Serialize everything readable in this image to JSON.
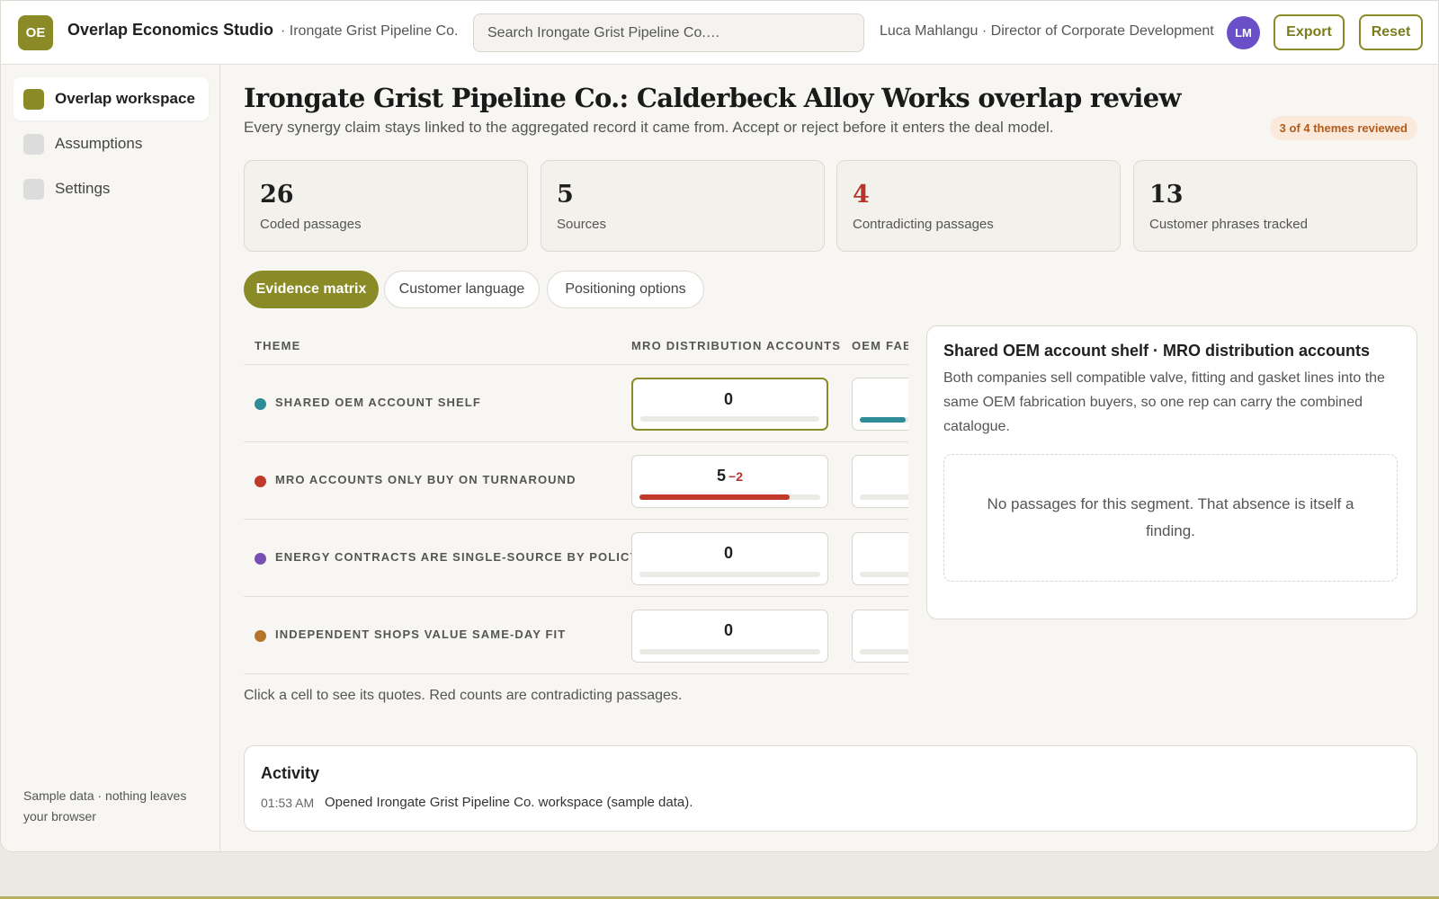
{
  "app": {
    "logo": "OE",
    "name": "Overlap Economics Studio",
    "company_crumb": "· Irongate Grist Pipeline Co.",
    "search_placeholder": "Search Irongate Grist Pipeline Co.…",
    "user": "Luca Mahlangu · Director of Corporate Development",
    "avatar": "LM",
    "export_label": "Export",
    "reset_label": "Reset"
  },
  "sidebar": {
    "items": [
      {
        "label": "Overlap workspace",
        "active": true
      },
      {
        "label": "Assumptions",
        "active": false
      },
      {
        "label": "Settings",
        "active": false
      }
    ],
    "footer": "Sample data · nothing leaves your browser"
  },
  "page": {
    "title": "Irongate Grist Pipeline Co.: Calderbeck Alloy Works overlap review",
    "subtitle": "Every synergy claim stays linked to the aggregated record it came from. Accept or reject before it enters the deal model.",
    "reviewed_badge": "3 of 4 themes reviewed"
  },
  "stats": [
    {
      "value": "26",
      "label": "Coded passages"
    },
    {
      "value": "5",
      "label": "Sources"
    },
    {
      "value": "4",
      "label": "Contradicting passages",
      "alert": true
    },
    {
      "value": "13",
      "label": "Customer phrases tracked"
    }
  ],
  "tabs": [
    "Evidence matrix",
    "Customer language",
    "Positioning options"
  ],
  "matrix": {
    "headers": {
      "theme": "THEME",
      "col1": "MRO DISTRIBUTION ACCOUNTS",
      "col2": "OEM FAB"
    },
    "rows": [
      {
        "theme": "SHARED OEM ACCOUNT SHELF",
        "color": "#2f8c96",
        "count": "0",
        "contra": "",
        "fill": 0,
        "fill_color": "#2f8c96",
        "col2_fill": 0.62,
        "col2_color": "#2f8c96",
        "selected": true
      },
      {
        "theme": "MRO ACCOUNTS ONLY BUY ON TURNAROUND",
        "color": "#c0392b",
        "count": "5",
        "contra": "−2",
        "fill": 0.83,
        "fill_color": "#c0392b",
        "col2_fill": 0,
        "col2_color": "#c0392b",
        "selected": false
      },
      {
        "theme": "ENERGY CONTRACTS ARE SINGLE-SOURCE BY POLICY",
        "color": "#7a4fb5",
        "count": "0",
        "contra": "",
        "fill": 0,
        "fill_color": "#7a4fb5",
        "col2_fill": 0,
        "col2_color": "#7a4fb5",
        "selected": false
      },
      {
        "theme": "INDEPENDENT SHOPS VALUE SAME-DAY FIT",
        "color": "#b8732a",
        "count": "0",
        "contra": "",
        "fill": 0,
        "fill_color": "#b8732a",
        "col2_fill": 0,
        "col2_color": "#b8732a",
        "selected": false
      }
    ],
    "note": "Click a cell to see its quotes. Red counts are contradicting passages."
  },
  "detail": {
    "title": "Shared OEM account shelf · MRO distribution accounts",
    "body": "Both companies sell compatible valve, fitting and gasket lines into the same OEM fabrication buyers, so one rep can carry the combined catalogue.",
    "empty": "No passages for this segment. That absence is itself a finding."
  },
  "activity": {
    "title": "Activity",
    "entries": [
      {
        "time": "01:53 AM",
        "text": "Opened Irongate Grist Pipeline Co. workspace (sample data)."
      }
    ]
  }
}
